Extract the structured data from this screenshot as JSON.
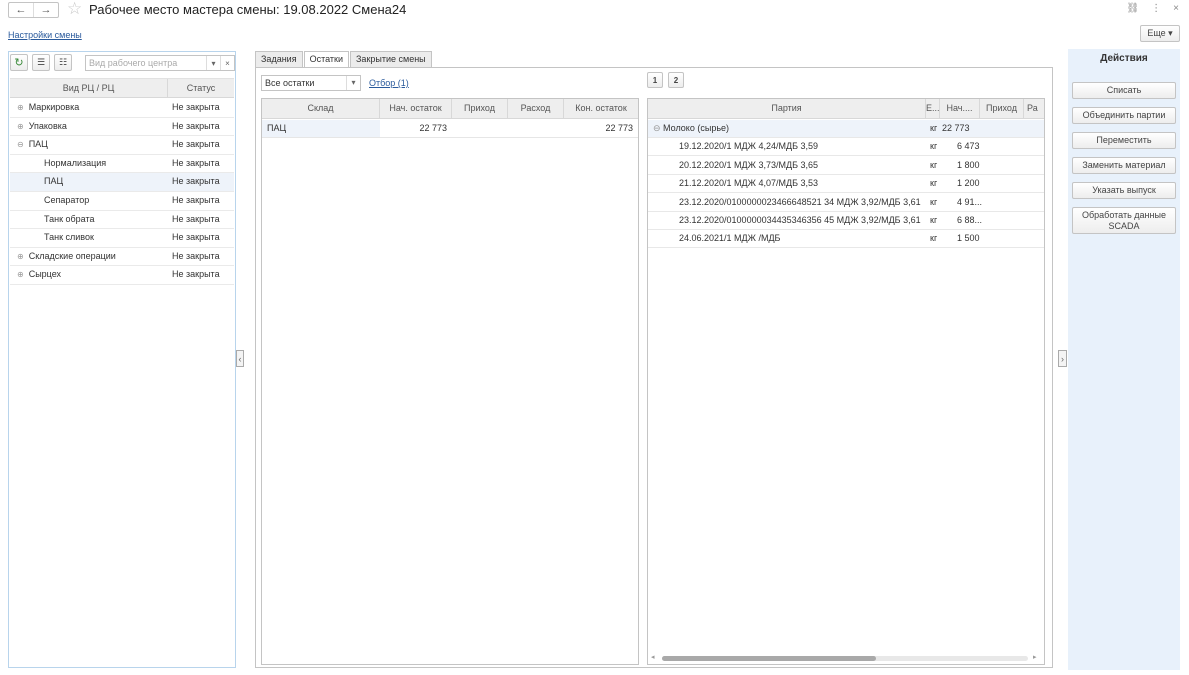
{
  "window": {
    "title": "Рабочее место мастера смены: 19.08.2022 Смена24",
    "back_glyph": "←",
    "forward_glyph": "→",
    "link_glyph": "🔗",
    "menu_glyph": "⋮",
    "close_glyph": "×"
  },
  "header": {
    "settings_link": "Настройки смены",
    "more_button": "Еще ▾"
  },
  "left_panel": {
    "search_placeholder": "Вид рабочего центра",
    "columns": [
      "Вид РЦ / РЦ",
      "Статус"
    ],
    "rows": [
      {
        "name": "Маркировка",
        "status": "Не закрыта",
        "level": 0,
        "expander": "⊕"
      },
      {
        "name": "Упаковка",
        "status": "Не закрыта",
        "level": 0,
        "expander": "⊕"
      },
      {
        "name": "ПАЦ",
        "status": "Не закрыта",
        "level": 0,
        "expander": "⊖"
      },
      {
        "name": "Нормализация",
        "status": "Не закрыта",
        "level": 1,
        "expander": ""
      },
      {
        "name": "ПАЦ",
        "status": "Не закрыта",
        "level": 1,
        "expander": "",
        "selected": true
      },
      {
        "name": "Сепаратор",
        "status": "Не закрыта",
        "level": 1,
        "expander": ""
      },
      {
        "name": "Танк обрата",
        "status": "Не закрыта",
        "level": 1,
        "expander": ""
      },
      {
        "name": "Танк сливок",
        "status": "Не закрыта",
        "level": 1,
        "expander": ""
      },
      {
        "name": "Складские операции",
        "status": "Не закрыта",
        "level": 0,
        "expander": "⊕"
      },
      {
        "name": "Сырцех",
        "status": "Не закрыта",
        "level": 0,
        "expander": "⊕"
      }
    ]
  },
  "tabs": [
    {
      "label": "Задания",
      "active": false
    },
    {
      "label": "Остатки",
      "active": true
    },
    {
      "label": "Закрытие смены",
      "active": false
    }
  ],
  "filter": {
    "select_value": "Все остатки",
    "link": "Отбор (1)"
  },
  "pager": [
    "1",
    "2"
  ],
  "stock_table": {
    "columns": [
      "Склад",
      "Нач. остаток",
      "Приход",
      "Расход",
      "Кон. остаток"
    ],
    "rows": [
      {
        "warehouse": "ПАЦ",
        "start": "22 773",
        "in": "",
        "out": "",
        "end": "22 773"
      }
    ]
  },
  "batch_table": {
    "columns": [
      "Партия",
      "Е...",
      "Нач....",
      "Приход",
      "Ра"
    ],
    "rows": [
      {
        "batch": "Молоко (сырье)",
        "unit": "кг",
        "start": "22 773",
        "group": true,
        "expander": "⊖"
      },
      {
        "batch": "19.12.2020/1  МДЖ 4,24/МДБ 3,59",
        "unit": "кг",
        "start": "6 473"
      },
      {
        "batch": "20.12.2020/1  МДЖ 3,73/МДБ 3,65",
        "unit": "кг",
        "start": "1 800"
      },
      {
        "batch": "21.12.2020/1  МДЖ 4,07/МДБ 3,53",
        "unit": "кг",
        "start": "1 200"
      },
      {
        "batch": "23.12.2020/0100000023466648521 34  МДЖ 3,92/МДБ 3,61",
        "unit": "кг",
        "start": "4 91..."
      },
      {
        "batch": "23.12.2020/0100000034435346356 45  МДЖ 3,92/МДБ 3,61",
        "unit": "кг",
        "start": "6 88..."
      },
      {
        "batch": "24.06.2021/1  МДЖ /МДБ",
        "unit": "кг",
        "start": "1 500"
      }
    ]
  },
  "actions": {
    "title": "Действия",
    "buttons": [
      "Списать",
      "Объединить партии",
      "Переместить",
      "Заменить материал",
      "Указать выпуск",
      "Обработать данные SCADA"
    ]
  }
}
